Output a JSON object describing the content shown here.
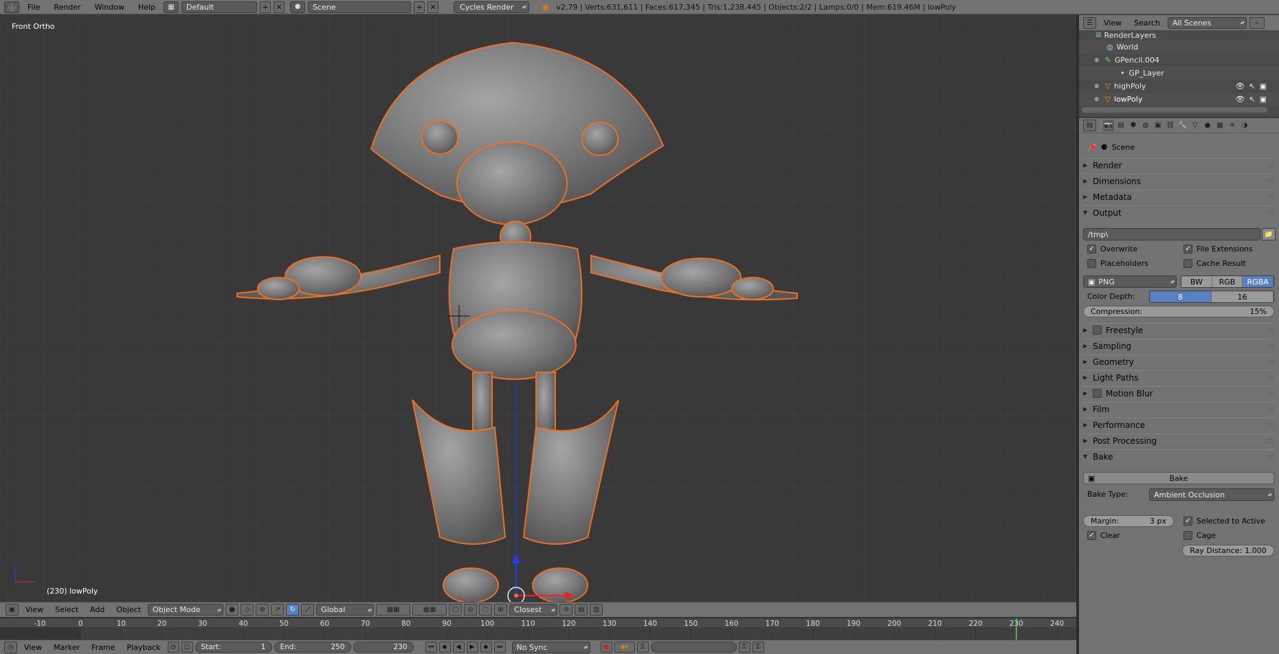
{
  "topbar": {
    "menus": [
      "File",
      "Render",
      "Window",
      "Help"
    ],
    "layout": "Default",
    "scene": "Scene",
    "engine": "Cycles Render",
    "stats": "v2.79 | Verts:631,611 | Faces:617,345 | Tris:1,238,445 | Objects:2/2 | Lamps:0/0 | Mem:619.46M | lowPoly"
  },
  "viewport": {
    "view_label": "Front Ortho",
    "object_label": "(230) lowPoly"
  },
  "view3d_header": {
    "menus": [
      "View",
      "Select",
      "Add",
      "Object"
    ],
    "mode": "Object Mode",
    "orientation": "Global",
    "snap": "Closest"
  },
  "timeline": {
    "ticks": [
      "-10",
      "0",
      "10",
      "20",
      "30",
      "40",
      "50",
      "60",
      "70",
      "80",
      "90",
      "100",
      "110",
      "120",
      "130",
      "140",
      "150",
      "160",
      "170",
      "180",
      "190",
      "200",
      "210",
      "220",
      "230",
      "240"
    ],
    "current_frame": 230
  },
  "bottombar": {
    "menus": [
      "View",
      "Marker",
      "Frame",
      "Playback"
    ],
    "start_label": "Start:",
    "start": "1",
    "end_label": "End:",
    "end": "250",
    "current": "230",
    "sync": "No Sync"
  },
  "outliner": {
    "menus": [
      "View",
      "Search"
    ],
    "filter": "All Scenes",
    "items": [
      "RenderLayers",
      "World",
      "GPencil.004",
      "GP_Layer",
      "highPoly",
      "lowPoly"
    ]
  },
  "properties": {
    "context": "Scene",
    "panels": {
      "render": "Render",
      "dimensions": "Dimensions",
      "metadata": "Metadata",
      "output": "Output",
      "freestyle": "Freestyle",
      "sampling": "Sampling",
      "geometry": "Geometry",
      "light_paths": "Light Paths",
      "motion_blur": "Motion Blur",
      "film": "Film",
      "performance": "Performance",
      "post_processing": "Post Processing",
      "bake": "Bake"
    },
    "output": {
      "path": "/tmp\\",
      "overwrite": "Overwrite",
      "file_extensions": "File Extensions",
      "placeholders": "Placeholders",
      "cache_result": "Cache Result",
      "format": "PNG",
      "color_modes": [
        "BW",
        "RGB",
        "RGBA"
      ],
      "color_depth_label": "Color Depth:",
      "color_depths": [
        "8",
        "16"
      ],
      "compression_label": "Compression:",
      "compression_value": "15%"
    },
    "bake": {
      "bake_button": "Bake",
      "bake_type_label": "Bake Type:",
      "bake_type": "Ambient Occlusion",
      "margin_label": "Margin:",
      "margin_value": "3 px",
      "selected_to_active": "Selected to Active",
      "clear": "Clear",
      "cage": "Cage",
      "ray_distance_label": "Ray Distance:",
      "ray_distance_value": "1.000"
    }
  }
}
